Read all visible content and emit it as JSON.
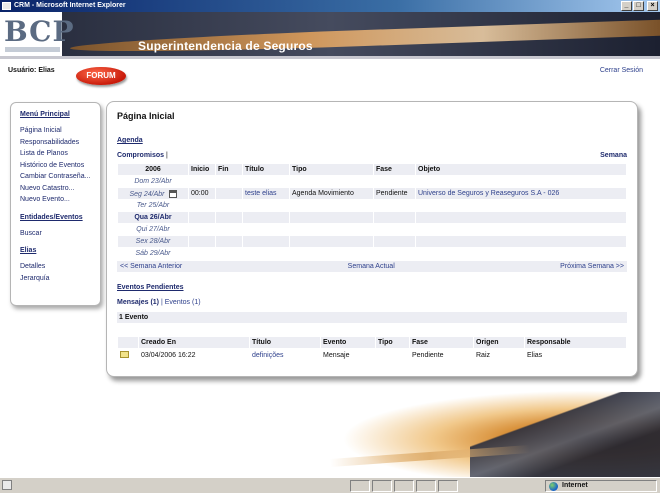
{
  "window": {
    "title": "CRM - Microsoft Internet Explorer",
    "buttons": {
      "minimize": "_",
      "maximize": "□",
      "close": "×"
    }
  },
  "header": {
    "logo": "BCP",
    "site_title": "Superintendencia de Seguros"
  },
  "userbar": {
    "user_label": "Usuário: Elias",
    "forum_label": "FORUM",
    "logout_label": "Cerrar Sesión"
  },
  "sidebar": {
    "main_menu_title": "Menú Principal",
    "main_menu_items": [
      "Página Inicial",
      "Responsabilidades",
      "Lista de Planos",
      "Histórico de Eventos",
      "Cambiar Contraseña...",
      "Nuevo Catastro...",
      "Nuevo Evento..."
    ],
    "entities_title": "Entidades/Eventos",
    "entities_items": [
      "Buscar"
    ],
    "user_title": "Elias",
    "user_items": [
      "Detalles",
      "Jerarquía"
    ]
  },
  "main": {
    "page_title": "Página Inicial",
    "agenda_title": "Agenda",
    "subnav": {
      "commitments": "Compromisos",
      "separator": "|",
      "week": "Semana"
    },
    "agenda_headers": [
      "2006",
      "Inicio",
      "Fin",
      "Título",
      "Tipo",
      "Fase",
      "Objeto"
    ],
    "agenda_rows": [
      {
        "day": "Dom 23/Abr",
        "start": "",
        "end": "",
        "title": "",
        "type": "",
        "phase": "",
        "object": ""
      },
      {
        "day": "Seg 24/Abr",
        "start": "00:00",
        "end": "",
        "title": "teste elias",
        "type": "Agenda Movimiento",
        "phase": "Pendiente",
        "object": "Universo de Seguros y Reaseguros S.A - 026"
      },
      {
        "day": "Ter 25/Abr",
        "start": "",
        "end": "",
        "title": "",
        "type": "",
        "phase": "",
        "object": ""
      },
      {
        "day": "Qua 26/Abr",
        "start": "",
        "end": "",
        "title": "",
        "type": "",
        "phase": "",
        "object": ""
      },
      {
        "day": "Qui 27/Abr",
        "start": "",
        "end": "",
        "title": "",
        "type": "",
        "phase": "",
        "object": ""
      },
      {
        "day": "Sex 28/Abr",
        "start": "",
        "end": "",
        "title": "",
        "type": "",
        "phase": "",
        "object": ""
      },
      {
        "day": "Sáb 29/Abr",
        "start": "",
        "end": "",
        "title": "",
        "type": "",
        "phase": "",
        "object": ""
      }
    ],
    "weeknav": {
      "prev": "<< Semana Anterior",
      "current": "Semana Actual",
      "next": "Próxima Semana >>"
    },
    "events_title": "Eventos Pendientes",
    "event_tabs": {
      "messages": "Mensajes (1)",
      "separator": "|",
      "events": "Eventos (1)"
    },
    "event_count": "1 Evento",
    "events_headers": [
      "",
      "Creado En",
      "Título",
      "Evento",
      "Tipo",
      "Fase",
      "Origen",
      "Responsable"
    ],
    "events_rows": [
      {
        "created": "03/04/2006 16:22",
        "title": "definições",
        "event": "Mensaje",
        "type": "",
        "phase": "Pendiente",
        "origin": "Raiz",
        "owner": "Elias"
      }
    ]
  },
  "statusbar": {
    "zone_label": "Internet"
  }
}
